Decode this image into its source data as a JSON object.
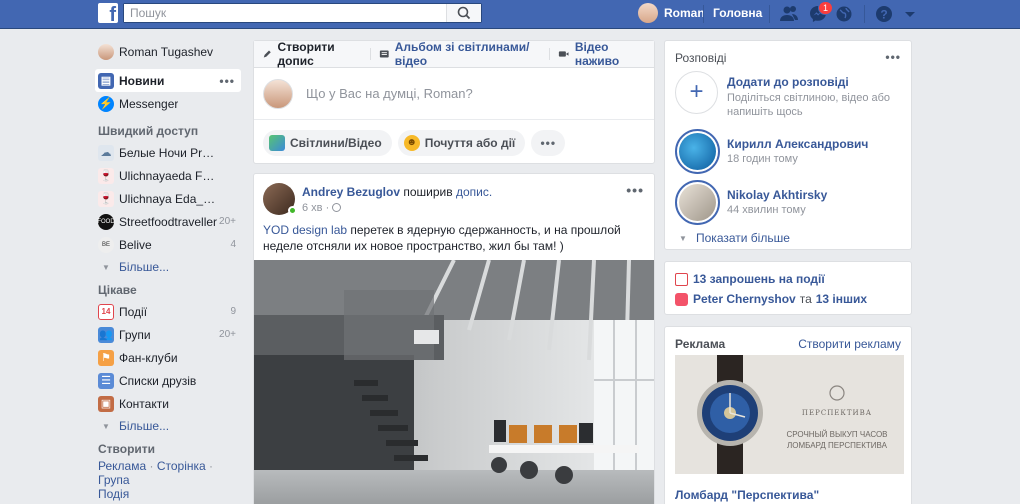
{
  "header": {
    "logo": "f",
    "search_placeholder": "Пошук",
    "user_name": "Roman",
    "home_label": "Головна",
    "messages_badge": "1"
  },
  "sidebar": {
    "profile": "Roman Tugashev",
    "main": [
      {
        "label": "Новини",
        "active": true
      },
      {
        "label": "Messenger"
      }
    ],
    "quick_title": "Швидкий доступ",
    "quick": [
      {
        "label": "Белые Ночи Previ...",
        "count": ""
      },
      {
        "label": "Ulichnayaeda Fami...",
        "count": ""
      },
      {
        "label": "Ulichnaya Eda_Pre...",
        "count": ""
      },
      {
        "label": "Streetfoodtraveller",
        "count": "20+"
      },
      {
        "label": "Belive",
        "count": "4"
      }
    ],
    "more1": "Більше...",
    "interest_title": "Цікаве",
    "interest": [
      {
        "label": "Події",
        "count": "9"
      },
      {
        "label": "Групи",
        "count": "20+"
      },
      {
        "label": "Фан-клуби",
        "count": ""
      },
      {
        "label": "Списки друзів",
        "count": ""
      },
      {
        "label": "Контакти",
        "count": ""
      }
    ],
    "more2": "Більше...",
    "create_title": "Створити",
    "create_links": [
      "Реклама",
      "Сторінка",
      "Група",
      "Подія"
    ]
  },
  "composer": {
    "tabs": [
      "Створити допис",
      "Альбом зі світлинами/відео",
      "Відео наживо"
    ],
    "placeholder": "Що у Вас на думці, Roman?",
    "buttons": [
      "Світлини/Відео",
      "Почуття або дії"
    ]
  },
  "post": {
    "author": "Andrey Bezuglov",
    "action": "поширив",
    "object": "допис.",
    "time": "6 хв",
    "link": "YOD design lab",
    "text": " перетек в ядерную сдержанность, и на прошлой неделе отсняли их новое пространство, жил бы там! )"
  },
  "stories": {
    "title": "Розповіді",
    "add_title": "Додати до розповіді",
    "add_desc": "Поділіться світлиною, відео або напишіть щось",
    "items": [
      {
        "name": "Кирилл Александрович",
        "time": "18 годин тому"
      },
      {
        "name": "Nikolay Akhtirsky",
        "time": "44 хвилин тому"
      }
    ],
    "show_more": "Показати більше"
  },
  "events": {
    "invites": "13 запрошень на події",
    "friend": "Peter Chernyshov",
    "connector": "та",
    "others": "13 інших"
  },
  "ads": {
    "title": "Реклама",
    "create": "Створити рекламу",
    "ad_name": "Ломбард \"Перспектива\"",
    "brand": "ПЕРСПЕКТИВА",
    "line1": "СРОЧНЫЙ ВЫКУП ЧАСОВ",
    "line2": "ЛОМБАРД ПЕРСПЕКТИВА"
  }
}
